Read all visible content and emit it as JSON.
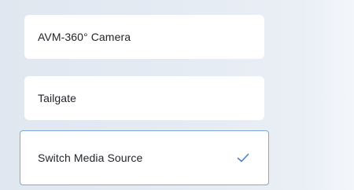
{
  "options": [
    {
      "label": "AVM-360° Camera",
      "selected": false
    },
    {
      "label": "Tailgate",
      "selected": false
    },
    {
      "label": "Switch Media Source",
      "selected": true
    }
  ],
  "icons": {
    "selected_indicator": "check-icon"
  },
  "colors": {
    "background": "#e3e9f2",
    "card": "#ffffff",
    "selected_border": "#86a6d6",
    "check": "#4d7ec9",
    "text": "#1f2329"
  }
}
